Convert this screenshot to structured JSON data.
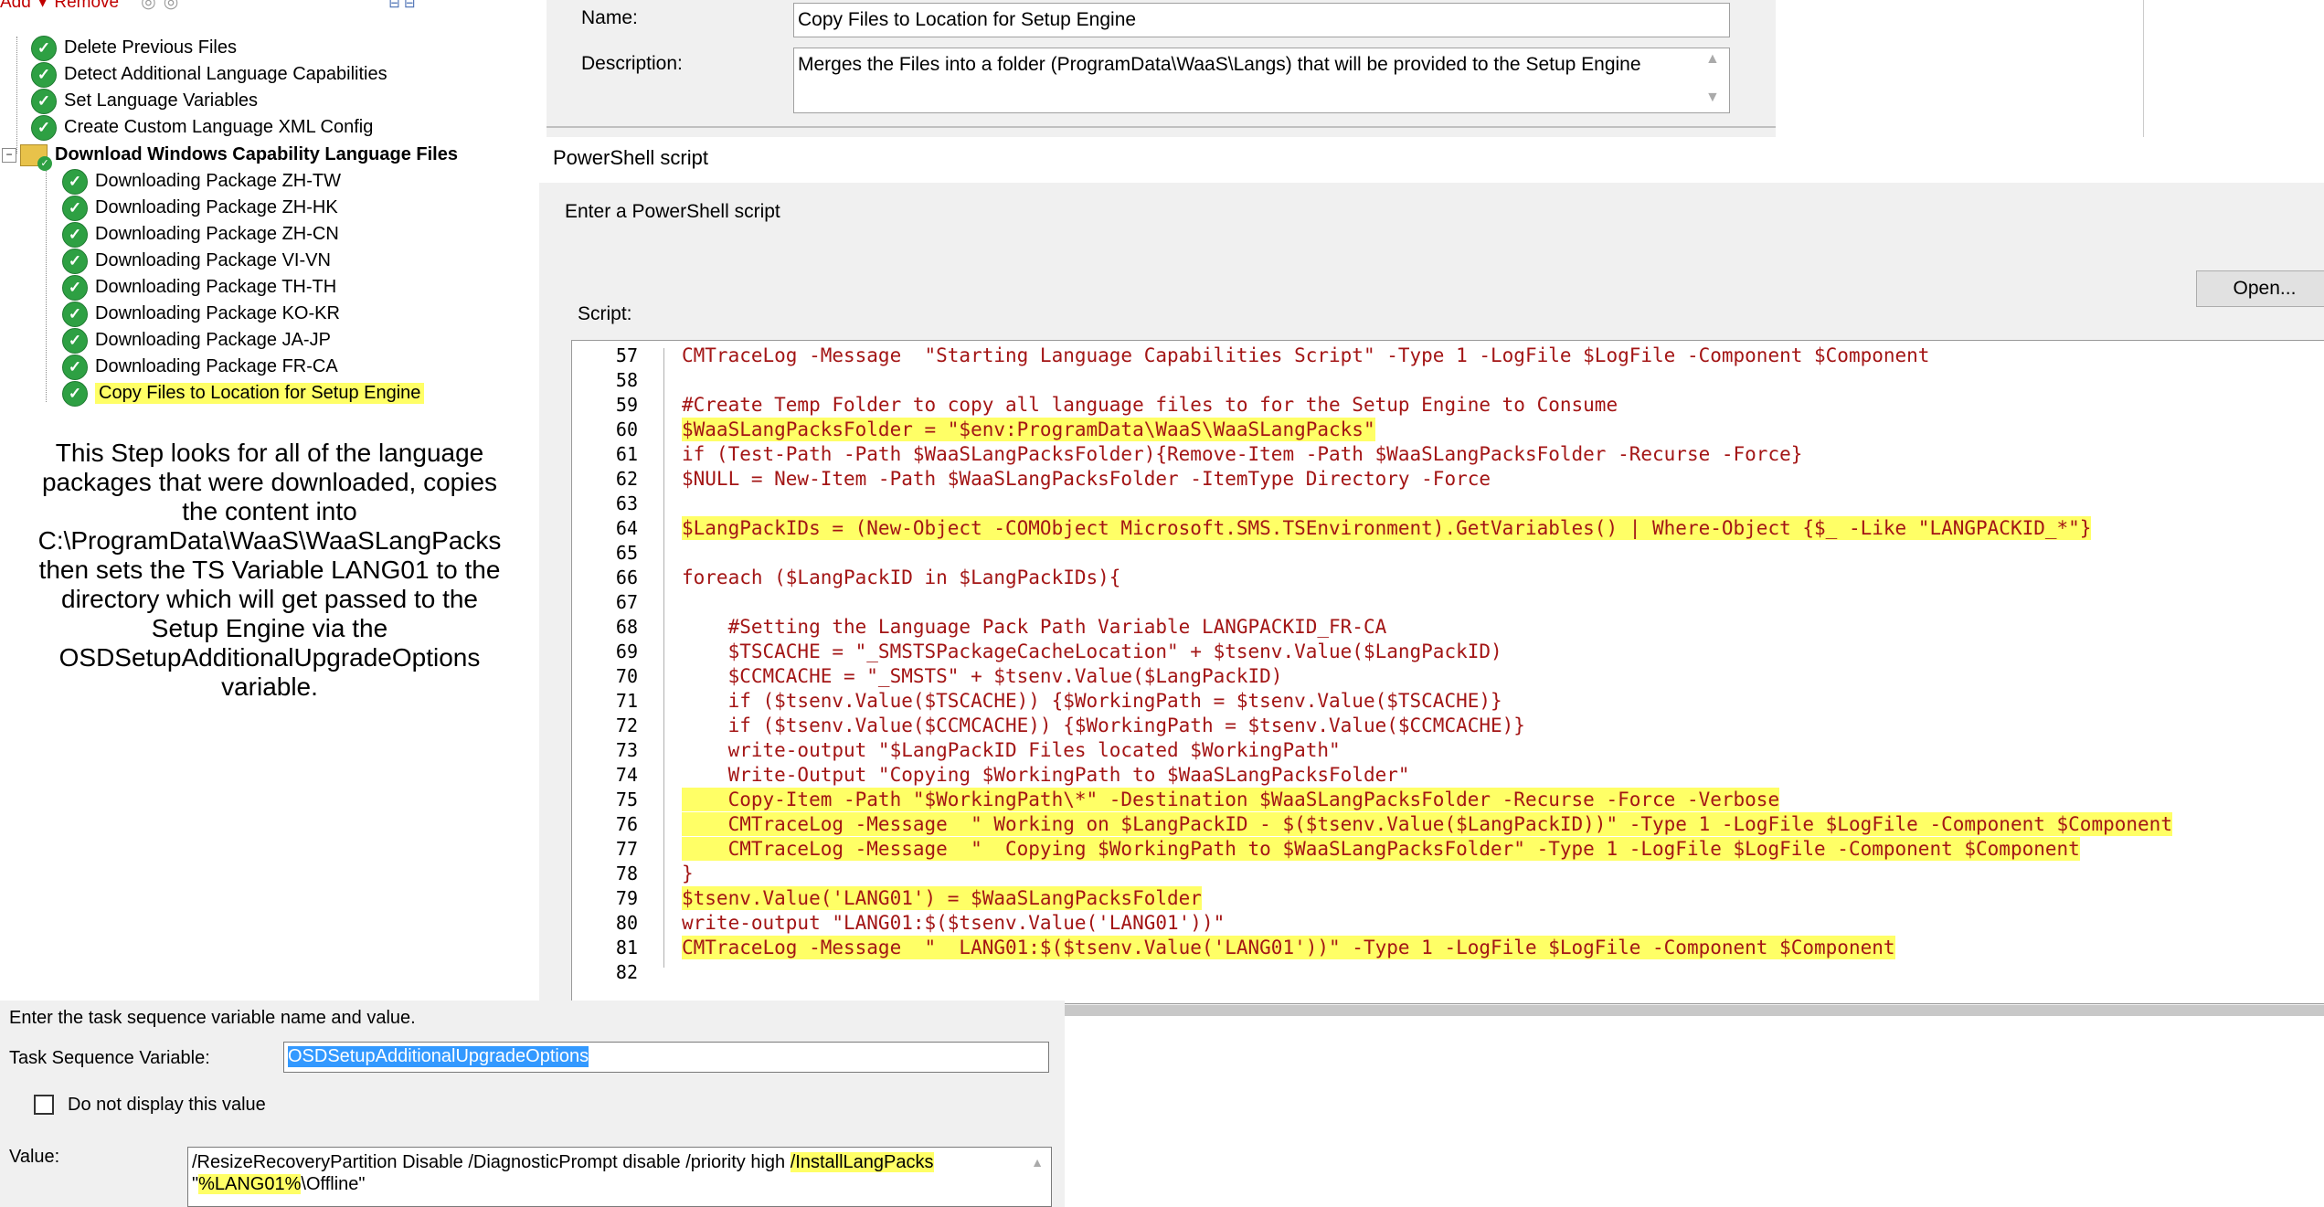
{
  "tree": {
    "toolbar": {
      "add_label": "Add",
      "remove_label": "Remove"
    },
    "items": [
      {
        "label": "Delete Previous Files"
      },
      {
        "label": "Detect Additional Language Capabilities"
      },
      {
        "label": "Set Language Variables"
      },
      {
        "label": "Create Custom Language XML Config"
      }
    ],
    "group": {
      "label": "Download Windows Capability Language Files"
    },
    "children": [
      {
        "label": "Downloading Package ZH-TW"
      },
      {
        "label": "Downloading Package ZH-HK"
      },
      {
        "label": "Downloading Package ZH-CN"
      },
      {
        "label": "Downloading Package VI-VN"
      },
      {
        "label": "Downloading Package TH-TH"
      },
      {
        "label": "Downloading Package KO-KR"
      },
      {
        "label": "Downloading Package JA-JP"
      },
      {
        "label": "Downloading Package FR-CA"
      },
      {
        "label": "Copy Files to Location for Setup Engine"
      }
    ]
  },
  "description_note": {
    "lines": [
      "This Step looks for all of the language",
      "packages that were downloaded, copies",
      "the content into",
      "C:\\ProgramData\\WaaS\\WaaSLangPacks",
      "then sets the TS Variable LANG01 to the",
      "directory which will get passed to the",
      "Setup Engine via the",
      "OSDSetupAdditionalUpgradeOptions",
      "variable."
    ]
  },
  "properties": {
    "name_label": "Name:",
    "name_value": "Copy Files to Location for Setup Engine",
    "description_label": "Description:",
    "description_value": "Merges the Files into a folder (ProgramData\\WaaS\\Langs) that will be provided to the Setup Engine"
  },
  "powershell": {
    "title": "PowerShell script",
    "prompt": "Enter a PowerShell script",
    "open_button": "Open...",
    "script_label": "Script:",
    "lines": [
      {
        "n": "57",
        "code": "CMTraceLog -Message  \"Starting Language Capabilities Script\" -Type 1 -LogFile $LogFile -Component $Component"
      },
      {
        "n": "58",
        "code": ""
      },
      {
        "n": "59",
        "code": "#Create Temp Folder to copy all language files to for the Setup Engine to Consume"
      },
      {
        "n": "60",
        "code": "$WaaSLangPacksFolder = \"$env:ProgramData\\WaaS\\WaaSLangPacks\""
      },
      {
        "n": "61",
        "code": "if (Test-Path -Path $WaaSLangPacksFolder){Remove-Item -Path $WaaSLangPacksFolder -Recurse -Force}"
      },
      {
        "n": "62",
        "code": "$NULL = New-Item -Path $WaaSLangPacksFolder -ItemType Directory -Force"
      },
      {
        "n": "63",
        "code": ""
      },
      {
        "n": "64",
        "code": "$LangPackIDs = (New-Object -COMObject Microsoft.SMS.TSEnvironment).GetVariables() | Where-Object {$_ -Like \"LANGPACKID_*\"}"
      },
      {
        "n": "65",
        "code": ""
      },
      {
        "n": "66",
        "code": "foreach ($LangPackID in $LangPackIDs){"
      },
      {
        "n": "67",
        "code": ""
      },
      {
        "n": "68",
        "code": "    #Setting the Language Pack Path Variable LANGPACKID_FR-CA"
      },
      {
        "n": "69",
        "code": "    $TSCACHE = \"_SMSTSPackageCacheLocation\" + $tsenv.Value($LangPackID)"
      },
      {
        "n": "70",
        "code": "    $CCMCACHE = \"_SMSTS\" + $tsenv.Value($LangPackID)"
      },
      {
        "n": "71",
        "code": "    if ($tsenv.Value($TSCACHE)) {$WorkingPath = $tsenv.Value($TSCACHE)}"
      },
      {
        "n": "72",
        "code": "    if ($tsenv.Value($CCMCACHE)) {$WorkingPath = $tsenv.Value($CCMCACHE)}"
      },
      {
        "n": "73",
        "code": "    write-output \"$LangPackID Files located $WorkingPath\""
      },
      {
        "n": "74",
        "code": "    Write-Output \"Copying $WorkingPath to $WaaSLangPacksFolder\""
      },
      {
        "n": "75",
        "code": "    Copy-Item -Path \"$WorkingPath\\*\" -Destination $WaaSLangPacksFolder -Recurse -Force -Verbose"
      },
      {
        "n": "76",
        "code": "    CMTraceLog -Message  \" Working on $LangPackID - $($tsenv.Value($LangPackID))\" -Type 1 -LogFile $LogFile -Component $Component"
      },
      {
        "n": "77",
        "code": "    CMTraceLog -Message  \"  Copying $WorkingPath to $WaaSLangPacksFolder\" -Type 1 -LogFile $LogFile -Component $Component"
      },
      {
        "n": "78",
        "code": "}"
      },
      {
        "n": "79",
        "code": "$tsenv.Value('LANG01') = $WaaSLangPacksFolder"
      },
      {
        "n": "80",
        "code": "write-output \"LANG01:$($tsenv.Value('LANG01'))\""
      },
      {
        "n": "81",
        "code": "CMTraceLog -Message  \"  LANG01:$($tsenv.Value('LANG01'))\" -Type 1 -LogFile $LogFile -Component $Component"
      },
      {
        "n": "82",
        "code": ""
      }
    ]
  },
  "tsvariable": {
    "prompt": "Enter the task sequence variable name and value.",
    "var_label": "Task Sequence Variable:",
    "var_value": "OSDSetupAdditionalUpgradeOptions",
    "checkbox_label": "Do not display this value",
    "value_label": "Value:",
    "value_part1": "/ResizeRecoveryPartition Disable /DiagnosticPrompt disable /priority high ",
    "value_part2": "/InstallLangPacks",
    "value_part3": "\"",
    "value_part4": "%LANG01%",
    "value_part5": "\\Offline\""
  },
  "colors": {
    "highlight": "#ffff66",
    "code": "#a31515",
    "success": "#2ea043"
  }
}
